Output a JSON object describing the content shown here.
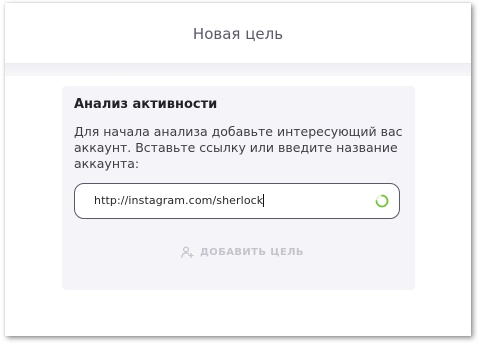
{
  "header": {
    "title": "Новая цель"
  },
  "card": {
    "title": "Анализ активности",
    "description": "Для начала анализа добавьте интересующий вас аккаунт. Вставьте ссылку или введите название аккаунта:",
    "input": {
      "value": "http://instagram.com/sherlock"
    },
    "spinner_icon": "loading-spinner-icon",
    "add_button": {
      "label": "ДОБАВИТЬ ЦЕЛЬ",
      "icon": "add-user-icon",
      "state": "disabled"
    }
  },
  "colors": {
    "accent": "#7ac143",
    "disabled": "#c4c4cc",
    "card_bg": "#f5f5f9"
  }
}
